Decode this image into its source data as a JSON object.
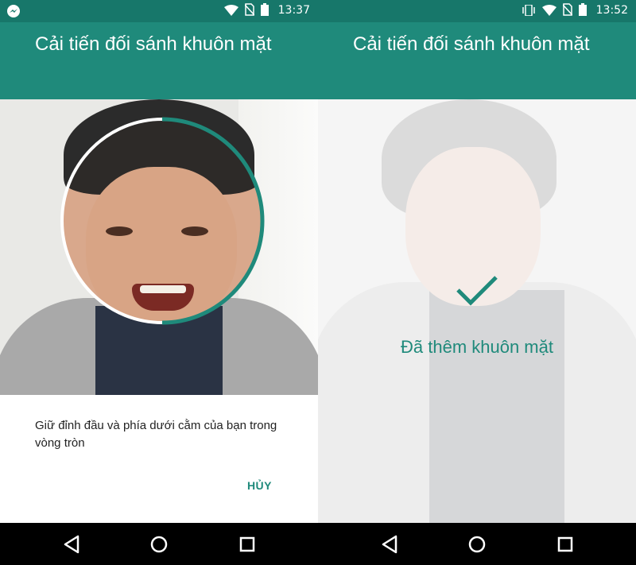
{
  "left": {
    "status": {
      "time": "13:37"
    },
    "appbar": {
      "title": "Cải tiến đối sánh khuôn mặt"
    },
    "dialog": {
      "message": "Giữ đỉnh đầu và phía dưới cằm của bạn trong vòng tròn",
      "cancel_label": "HỦY"
    }
  },
  "right": {
    "status": {
      "time": "13:52"
    },
    "appbar": {
      "title": "Cải tiến đối sánh khuôn mặt"
    },
    "confirmation": "Đã thêm khuôn mặt"
  },
  "colors": {
    "accent": "#1f8a7b",
    "statusbar": "#17776a"
  },
  "icons": [
    "messenger-icon",
    "wifi-icon",
    "no-sim-icon",
    "battery-icon",
    "vibrate-icon",
    "back-icon",
    "home-icon",
    "recents-icon",
    "check-icon"
  ]
}
